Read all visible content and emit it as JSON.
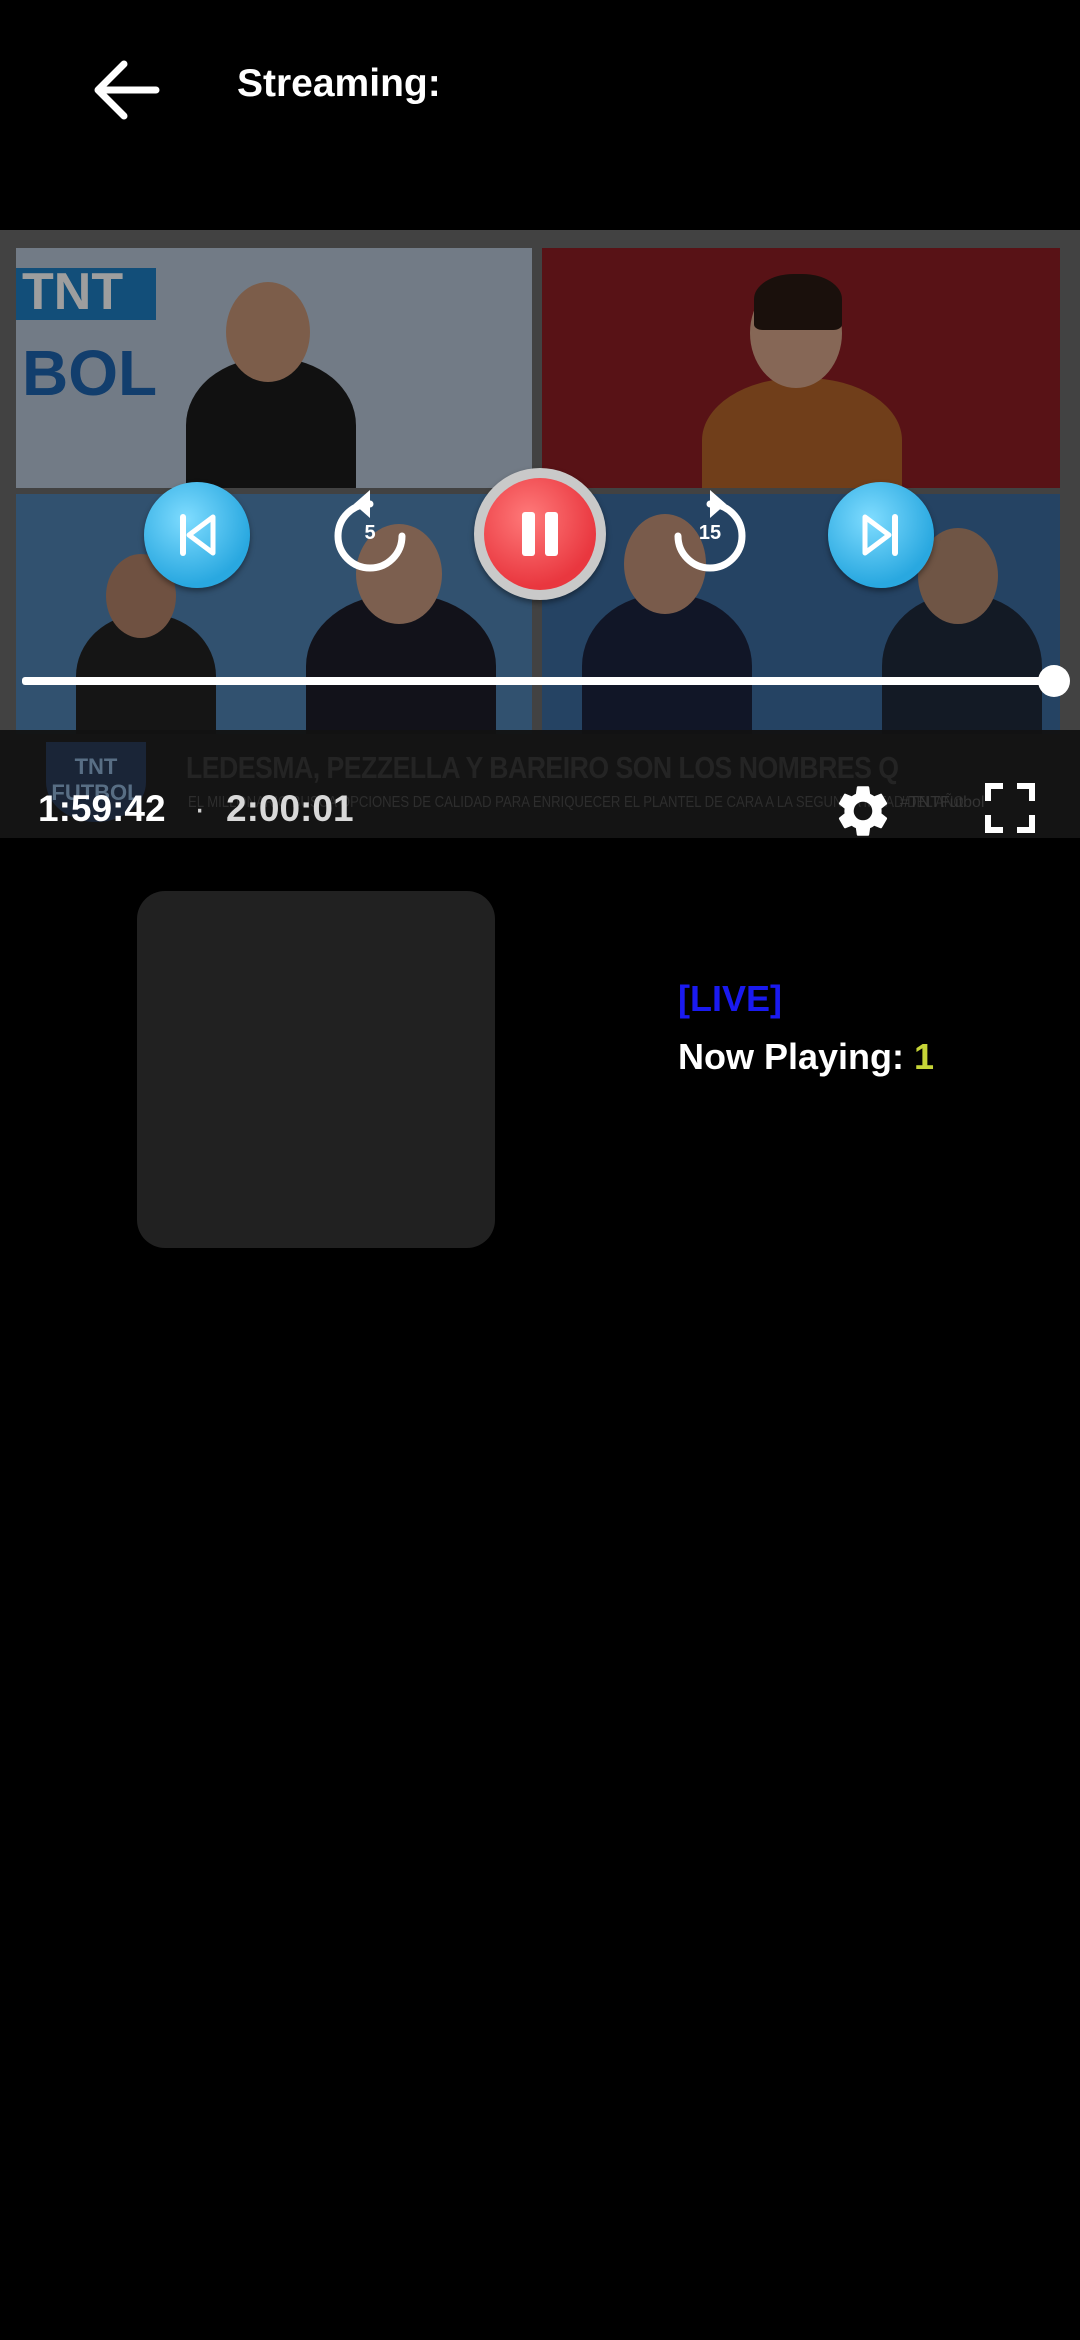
{
  "header": {
    "back_icon": "arrow-left-icon",
    "title": "Streaming:"
  },
  "video": {
    "logo_text_top": "TNT",
    "logo_text_bottom": "BOL",
    "lower_third": {
      "badge_line1": "TNT",
      "badge_line2": "FUTBOL",
      "headline": "LEDESMA, PEZZELLA Y BAREIRO SON LOS NOMBRES QUE SUENAN MÁS FUERTE EN RIVER",
      "subheadline": "EL MILLONARIO BUSCA OPCIONES DE CALIDAD PARA ENRIQUECER EL PLANTEL DE CARA A LA SEGUNDA MITAD DEL AÑO",
      "hashtag": "#TNTFutbol"
    }
  },
  "player": {
    "controls": {
      "previous_icon": "skip-previous-icon",
      "rewind_icon": "replay-icon",
      "rewind_seconds": "5",
      "pause_icon": "pause-icon",
      "forward_icon": "forward-icon",
      "forward_seconds": "15",
      "next_icon": "skip-next-icon",
      "settings_icon": "gear-icon",
      "fullscreen_icon": "fullscreen-icon"
    },
    "progress_fraction": 0.998,
    "time_current": "1:59:42",
    "time_separator": "·",
    "time_total": "2:00:01"
  },
  "info": {
    "live_label": "[LIVE]",
    "now_playing_label": "Now Playing:",
    "now_playing_value": "1"
  },
  "colors": {
    "background": "#000000",
    "control_blue": "#29a8e0",
    "pause_red": "#e9373f",
    "live_blue": "#1a1af0",
    "now_playing_value": "#c6d437",
    "thumbnail_bg": "#212121"
  }
}
